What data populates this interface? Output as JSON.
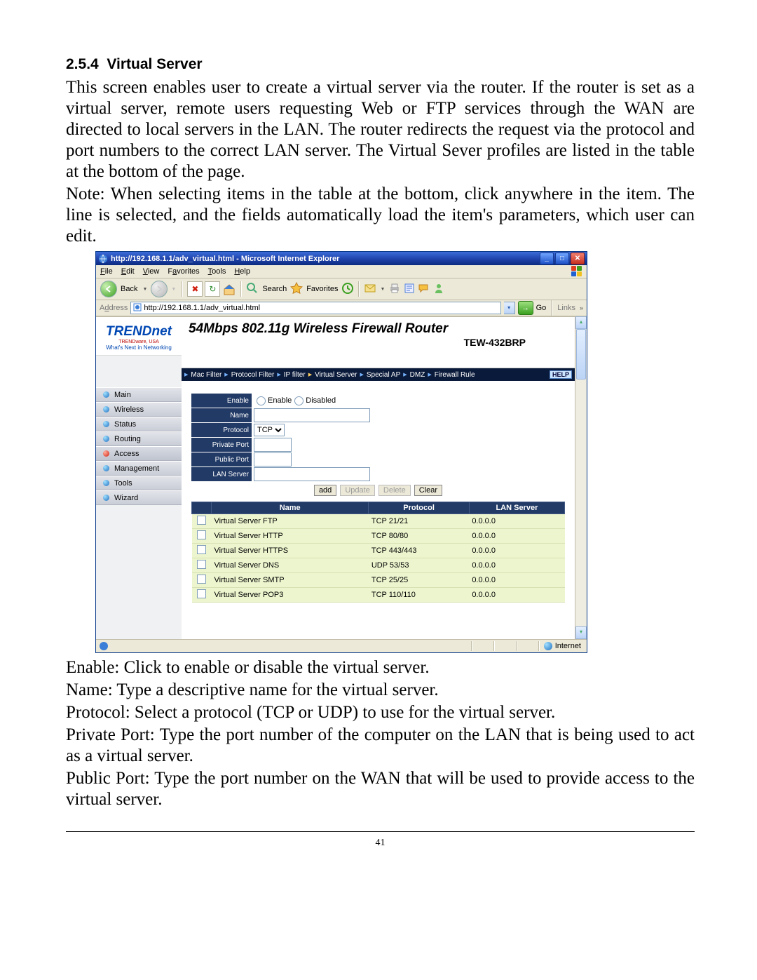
{
  "section": {
    "num": "2.5.4",
    "title": "Virtual Server"
  },
  "paras": {
    "p1": "This screen enables user to create a virtual server via the router. If the router is set as a virtual server, remote users requesting Web or FTP services through the WAN are directed to local servers in the LAN. The router redirects the request via the protocol and port numbers to the correct LAN server. The Virtual Sever profiles are listed in the table at the bottom of the page.",
    "p2": "Note: When selecting items in the table at the bottom, click anywhere in the item. The line is selected, and the fields automatically load the item's parameters, which user can edit.",
    "p3": "Enable: Click to enable or disable the virtual server.",
    "p4": "Name: Type a descriptive name for the virtual server.",
    "p5": "Protocol: Select a protocol (TCP or UDP) to use for the virtual server.",
    "p6": "Private Port: Type the port number of the computer on the LAN that is being used to act as a virtual server.",
    "p7": "Public Port: Type the port number on the WAN that will be used to provide access to the virtual server."
  },
  "page_num": "41",
  "br": {
    "title": "http://192.168.1.1/adv_virtual.html - Microsoft Internet Explorer",
    "menu": {
      "file": "File",
      "edit": "Edit",
      "view": "View",
      "favorites": "Favorites",
      "tools": "Tools",
      "help": "Help"
    },
    "tb": {
      "back": "Back",
      "search": "Search",
      "favorites": "Favorites"
    },
    "addr": {
      "label": "Address",
      "value": "http://192.168.1.1/adv_virtual.html",
      "go": "Go",
      "links": "Links"
    },
    "status": "Internet"
  },
  "router": {
    "brand": "TRENDnet",
    "sub1": "TRENDware, USA",
    "sub2": "What's Next in Networking",
    "banner1": "54Mbps 802.11g Wireless Firewall Router",
    "banner2": "TEW-432BRP",
    "nav": [
      "Main",
      "Wireless",
      "Status",
      "Routing",
      "Access",
      "Management",
      "Tools",
      "Wizard"
    ],
    "nav_active": 4,
    "tabs": [
      "Mac Filter",
      "Protocol Filter",
      "IP filter",
      "Virtual Server",
      "Special AP",
      "DMZ",
      "Firewall Rule"
    ],
    "tab_active": 3,
    "help": "HELP",
    "form": {
      "enable_lbl": "Enable",
      "enable_opt1": "Enable",
      "enable_opt2": "Disabled",
      "name_lbl": "Name",
      "protocol_lbl": "Protocol",
      "protocol_val": "TCP",
      "priv_lbl": "Private Port",
      "pub_lbl": "Public Port",
      "lan_lbl": "LAN Server"
    },
    "buttons": {
      "add": "add",
      "update": "Update",
      "delete": "Delete",
      "clear": "Clear"
    },
    "th": {
      "name": "Name",
      "protocol": "Protocol",
      "lan": "LAN Server"
    },
    "rows": [
      {
        "name": "Virtual Server FTP",
        "protocol": "TCP 21/21",
        "lan": "0.0.0.0"
      },
      {
        "name": "Virtual Server HTTP",
        "protocol": "TCP 80/80",
        "lan": "0.0.0.0"
      },
      {
        "name": "Virtual Server HTTPS",
        "protocol": "TCP 443/443",
        "lan": "0.0.0.0"
      },
      {
        "name": "Virtual Server DNS",
        "protocol": "UDP 53/53",
        "lan": "0.0.0.0"
      },
      {
        "name": "Virtual Server SMTP",
        "protocol": "TCP 25/25",
        "lan": "0.0.0.0"
      },
      {
        "name": "Virtual Server POP3",
        "protocol": "TCP 110/110",
        "lan": "0.0.0.0"
      }
    ]
  }
}
